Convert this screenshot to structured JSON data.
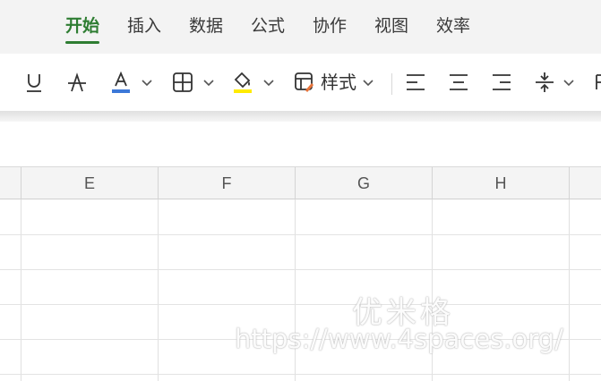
{
  "menu": {
    "items": [
      {
        "label": "开始",
        "active": true
      },
      {
        "label": "插入"
      },
      {
        "label": "数据"
      },
      {
        "label": "公式"
      },
      {
        "label": "协作"
      },
      {
        "label": "视图"
      },
      {
        "label": "效率"
      }
    ]
  },
  "toolbar": {
    "icons": [
      "underline-icon",
      "strikethrough-icon",
      "font-color-icon",
      "borders-icon",
      "fill-color-icon",
      "cell-style-icon",
      "align-left-icon",
      "align-center-icon",
      "align-right-icon",
      "vertical-align-middle-icon"
    ],
    "style_label": "样式",
    "accent_color": "#2e7d32",
    "font_color_bar": "#3c78d8",
    "fill_color_bar": "#ffeb00"
  },
  "sheet": {
    "columns": [
      "E",
      "F",
      "G",
      "H"
    ]
  },
  "watermark": {
    "text": "优米格",
    "url": "https://www.4spaces.org/"
  }
}
